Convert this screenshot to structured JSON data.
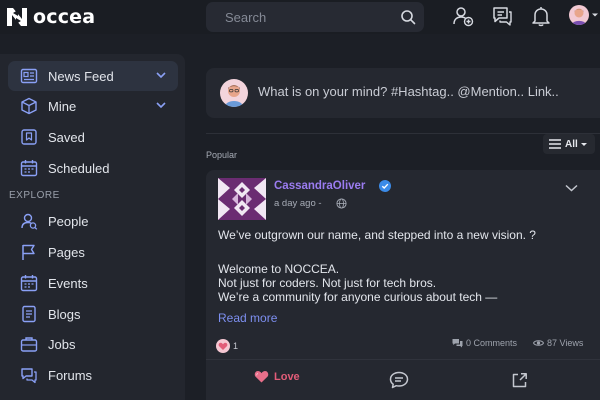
{
  "brand": {
    "name": "occea",
    "accent": "#9b7cf0"
  },
  "search": {
    "placeholder": "Search"
  },
  "topbar_icons": [
    "add-user-icon",
    "messages-icon",
    "bell-icon"
  ],
  "sidebar": {
    "items": [
      {
        "label": "News Feed",
        "icon": "news-feed-icon",
        "active": true,
        "has_chevron": true
      },
      {
        "label": "Mine",
        "icon": "cube-icon",
        "active": false,
        "has_chevron": true
      },
      {
        "label": "Saved",
        "icon": "bookmark-icon",
        "active": false
      },
      {
        "label": "Scheduled",
        "icon": "calendar-icon",
        "active": false
      }
    ],
    "explore_heading": "EXPLORE",
    "explore_items": [
      {
        "label": "People",
        "icon": "people-icon"
      },
      {
        "label": "Pages",
        "icon": "flag-icon"
      },
      {
        "label": "Events",
        "icon": "calendar-icon"
      },
      {
        "label": "Blogs",
        "icon": "document-icon"
      },
      {
        "label": "Jobs",
        "icon": "briefcase-icon"
      },
      {
        "label": "Forums",
        "icon": "forum-icon"
      }
    ]
  },
  "composer": {
    "placeholder": "What is on your mind? #Hashtag.. @Mention.. Link.."
  },
  "feed": {
    "filter_label": "All",
    "section_label": "Popular"
  },
  "post": {
    "author": "CassandraOliver",
    "verified": true,
    "time": "a day ago -",
    "lines": [
      "We’ve outgrown our name, and stepped into a new vision. ?",
      "",
      "Welcome to NOCCEA.",
      "Not just for coders. Not just for tech bros.",
      "We’re a community for anyone curious about tech —"
    ],
    "read_more": "Read more",
    "reaction_count": "1",
    "comments": "0 Comments",
    "views": "87 Views",
    "love_label": "Love",
    "love_color": "#e25c78"
  }
}
